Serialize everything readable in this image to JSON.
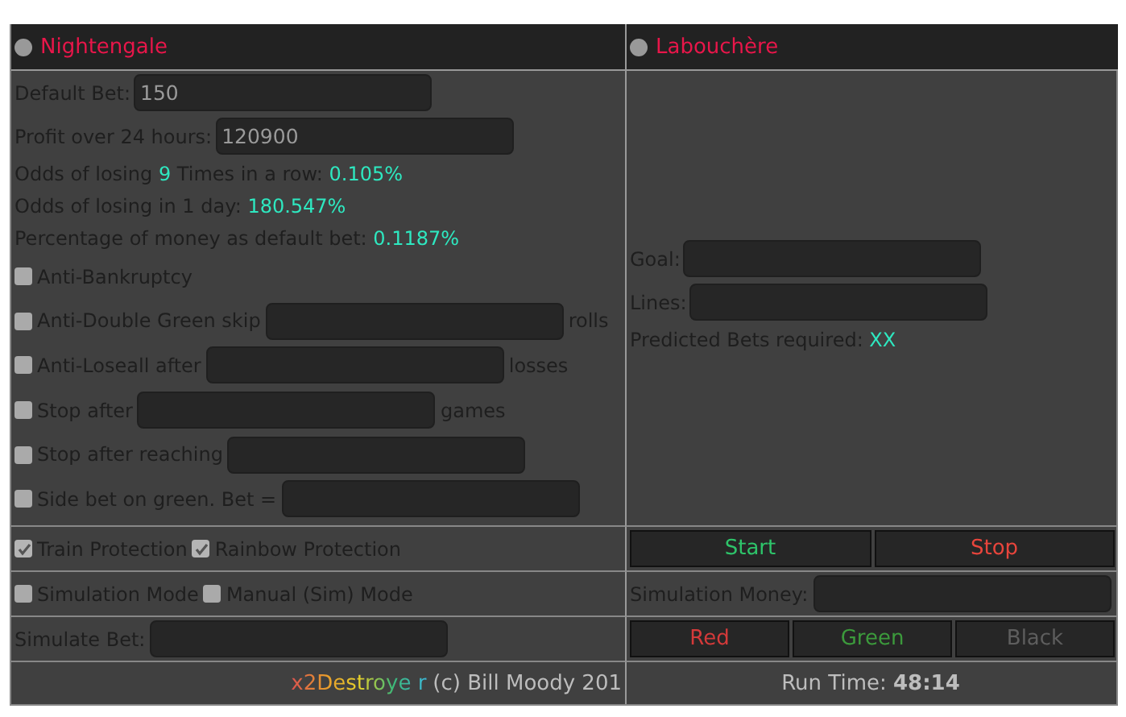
{
  "left": {
    "title": "Nightengale",
    "selected": false,
    "fields": [
      {
        "label": "Default Bet:",
        "value": "150"
      },
      {
        "label": "Profit over 24 hours:",
        "value": "120900"
      }
    ],
    "stats": [
      {
        "parts": [
          {
            "text": "Odds of losing ",
            "highlight": false
          },
          {
            "text": "9",
            "highlight": true
          },
          {
            "text": " Times in a row: ",
            "highlight": false
          },
          {
            "text": "0.105%",
            "highlight": true
          }
        ]
      },
      {
        "parts": [
          {
            "text": "Odds of losing in 1 day: ",
            "highlight": false
          },
          {
            "text": "180.547%",
            "highlight": true
          }
        ]
      },
      {
        "parts": [
          {
            "text": "Percentage of money as default bet: ",
            "highlight": false
          },
          {
            "text": "0.1187%",
            "highlight": true
          }
        ]
      }
    ],
    "options": [
      {
        "kind": "plain",
        "label": "Anti-Bankruptcy",
        "checked": false
      },
      {
        "kind": "input",
        "label": "Anti-Double Green skip",
        "checked": false,
        "suffix": "rolls"
      },
      {
        "kind": "input",
        "label": "Anti-Loseall after",
        "checked": false,
        "suffix": "losses"
      },
      {
        "kind": "input",
        "label": "Stop after",
        "checked": false,
        "suffix": "games"
      },
      {
        "kind": "input",
        "label": "Stop after reaching",
        "checked": false
      },
      {
        "kind": "input",
        "label": "Side bet on green. Bet =",
        "checked": false
      }
    ],
    "protections": [
      {
        "label": "Train Protection",
        "checked": true
      },
      {
        "label": "Rainbow Protection",
        "checked": true
      }
    ],
    "modes": [
      {
        "label": "Simulation Mode",
        "checked": false
      },
      {
        "label": "Manual (Sim) Mode",
        "checked": false
      }
    ],
    "simulate_bet": {
      "label": "Simulate Bet:"
    },
    "footer": {
      "brand": "x2Destroye r",
      "credit": "(c) Bill Moody 201"
    }
  },
  "right": {
    "title": "Labouchère",
    "selected": false,
    "fields": [
      {
        "label": "Goal:"
      },
      {
        "label": "Lines:"
      }
    ],
    "predicted": {
      "label": "Predicted Bets required: ",
      "value": "XX"
    },
    "actions": [
      {
        "label": "Start",
        "color": "#2ec46a"
      },
      {
        "label": "Stop",
        "color": "#e8453c"
      }
    ],
    "simulation_money": {
      "label": "Simulation Money:"
    },
    "bets": [
      {
        "label": "Red",
        "color": "#d43a3a"
      },
      {
        "label": "Green",
        "color": "#3c9a3c"
      },
      {
        "label": "Black",
        "color": "#5e5e5e"
      }
    ],
    "run_time": {
      "label": "Run Time: ",
      "value": "48:14"
    }
  }
}
